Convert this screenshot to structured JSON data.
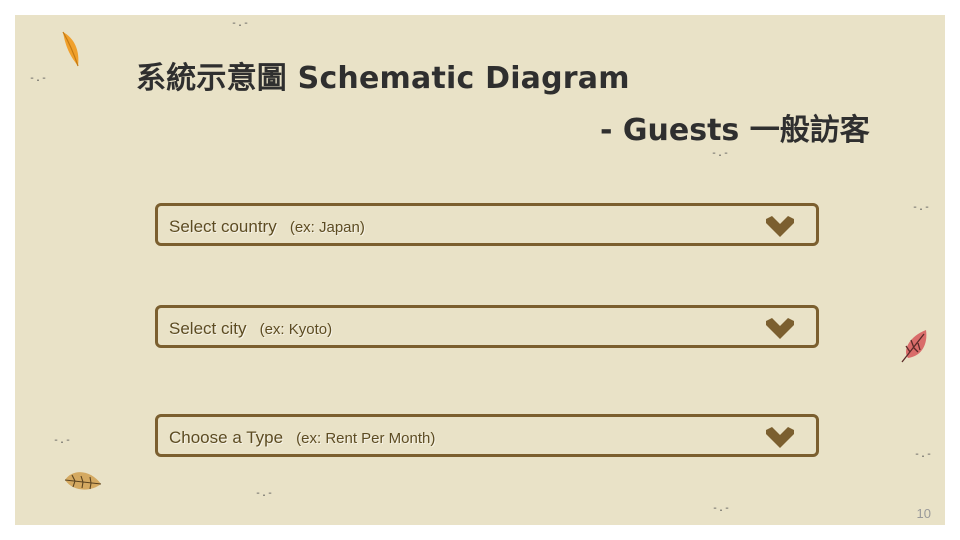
{
  "title": {
    "line1": "系統示意圖 Schematic Diagram",
    "line2": "- Guests 一般訪客"
  },
  "dropdowns": [
    {
      "label": "Select country",
      "hint": "(ex: Japan)",
      "icon": "chevron-down-icon"
    },
    {
      "label": "Select city",
      "hint": "(ex: Kyoto)",
      "icon": "chevron-down-icon"
    },
    {
      "label": "Choose a Type",
      "hint": "(ex: Rent Per Month)",
      "icon": "chevron-down-icon"
    }
  ],
  "page_number": "10",
  "colors": {
    "background": "#e9e2c7",
    "border": "#7b5f2f",
    "chevron": "#7b5f2f",
    "title": "#2f2f2f"
  },
  "decorations": [
    "orange-leaf-icon",
    "red-leaf-icon",
    "tan-leaf-icon"
  ]
}
